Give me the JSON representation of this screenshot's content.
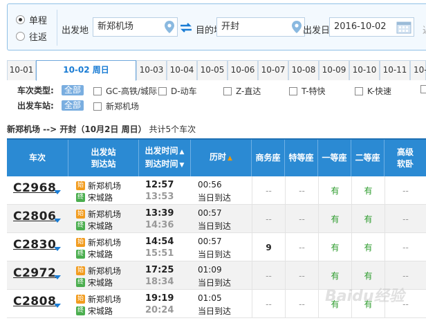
{
  "search": {
    "trip_type": [
      {
        "label": "单程",
        "selected": true
      },
      {
        "label": "往返",
        "selected": false
      }
    ],
    "from_label": "出发地",
    "from_value": "新郑机场",
    "to_label": "目的地",
    "to_value": "开封",
    "date_label": "出发日",
    "date_value": "2016-10-02",
    "return_label_cut": "返"
  },
  "date_tabs": [
    {
      "label": "10-01",
      "active": false
    },
    {
      "label": "10-02 周日",
      "active": true
    },
    {
      "label": "10-03",
      "active": false
    },
    {
      "label": "10-04",
      "active": false
    },
    {
      "label": "10-05",
      "active": false
    },
    {
      "label": "10-06",
      "active": false
    },
    {
      "label": "10-07",
      "active": false
    },
    {
      "label": "10-08",
      "active": false
    },
    {
      "label": "10-09",
      "active": false
    },
    {
      "label": "10-10",
      "active": false
    },
    {
      "label": "10-11",
      "active": false
    },
    {
      "label": "10-",
      "active": false
    }
  ],
  "filters": {
    "type_label": "车次类型:",
    "all_label": "全部",
    "types": [
      "GC-高铁/城际",
      "D-动车",
      "Z-直达",
      "T-特快",
      "K-快速"
    ],
    "station_label": "出发车站:",
    "stations": [
      "新郑机场"
    ]
  },
  "summary": {
    "route": "新郑机场 --> 开封（10月2日  周日）",
    "count": "共计5个车次"
  },
  "table": {
    "headers": {
      "train": "车次",
      "station_line1": "出发站",
      "station_line2": "到达站",
      "time_line1": "出发时间",
      "time_line2": "到达时间",
      "duration": "历时",
      "business": "商务座",
      "premium": "特等座",
      "first": "一等座",
      "second": "二等座",
      "soft_line1": "高级",
      "soft_line2": "软卧"
    },
    "start_badge": "始",
    "end_badge": "终",
    "rows": [
      {
        "train": "C2968",
        "from": "新郑机场",
        "to": "宋城路",
        "dep": "12:57",
        "arr": "13:53",
        "duration": "00:56",
        "arrival_note": "当日到达",
        "business": "--",
        "premium": "--",
        "first": "有",
        "second": "有",
        "soft": "--"
      },
      {
        "train": "C2806",
        "from": "新郑机场",
        "to": "宋城路",
        "dep": "13:39",
        "arr": "14:36",
        "duration": "00:57",
        "arrival_note": "当日到达",
        "business": "--",
        "premium": "--",
        "first": "有",
        "second": "有",
        "soft": "--"
      },
      {
        "train": "C2830",
        "from": "新郑机场",
        "to": "宋城路",
        "dep": "14:54",
        "arr": "15:51",
        "duration": "00:57",
        "arrival_note": "当日到达",
        "business": "9",
        "premium": "--",
        "first": "有",
        "second": "有",
        "soft": "--"
      },
      {
        "train": "C2972",
        "from": "新郑机场",
        "to": "宋城路",
        "dep": "17:25",
        "arr": "18:34",
        "duration": "01:09",
        "arrival_note": "当日到达",
        "business": "--",
        "premium": "--",
        "first": "有",
        "second": "有",
        "soft": "--"
      },
      {
        "train": "C2808",
        "from": "新郑机场",
        "to": "宋城路",
        "dep": "19:19",
        "arr": "20:24",
        "duration": "01:05",
        "arrival_note": "当日到达",
        "business": "--",
        "premium": "--",
        "first": "有",
        "second": "有",
        "soft": "--"
      }
    ]
  },
  "colors": {
    "header_blue": "#2b8ad3",
    "available_green": "#2b9b2b",
    "active_tab_blue": "#1a7cd4",
    "sort_orange": "#f39800"
  },
  "watermark": "Baidu经验"
}
